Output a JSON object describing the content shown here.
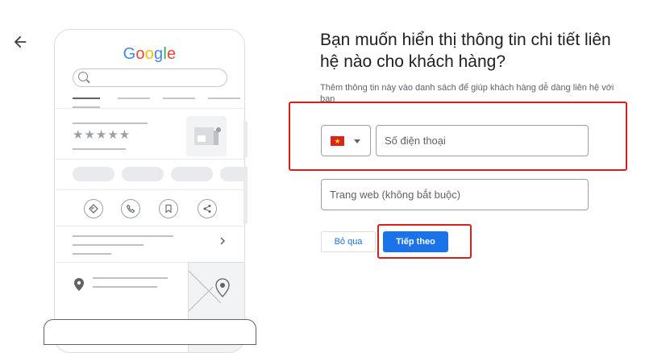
{
  "heading": "Bạn muốn hiển thị thông tin chi tiết liên hệ nào cho khách hàng?",
  "subtext": "Thêm thông tin này vào danh sách để giúp khách hàng dễ dàng liên hệ với bạn",
  "phone_preview": {
    "logo_letters": [
      "G",
      "o",
      "o",
      "g",
      "l",
      "e"
    ],
    "logo_colors": [
      "#4285f4",
      "#ea4335",
      "#fbbc05",
      "#4285f4",
      "#34a853",
      "#ea4335"
    ],
    "stars": "★★★★★"
  },
  "form": {
    "country_flag_icon": "vietnam-flag-icon",
    "phone_placeholder": "Số điện thoại",
    "website_placeholder": "Trang web (không bắt buộc)"
  },
  "buttons": {
    "skip": "Bỏ qua",
    "next": "Tiếp theo"
  },
  "colors": {
    "primary": "#1a73e8",
    "highlight": "#d91c1c",
    "flag_red": "#da251d",
    "flag_star": "#ffde00"
  }
}
